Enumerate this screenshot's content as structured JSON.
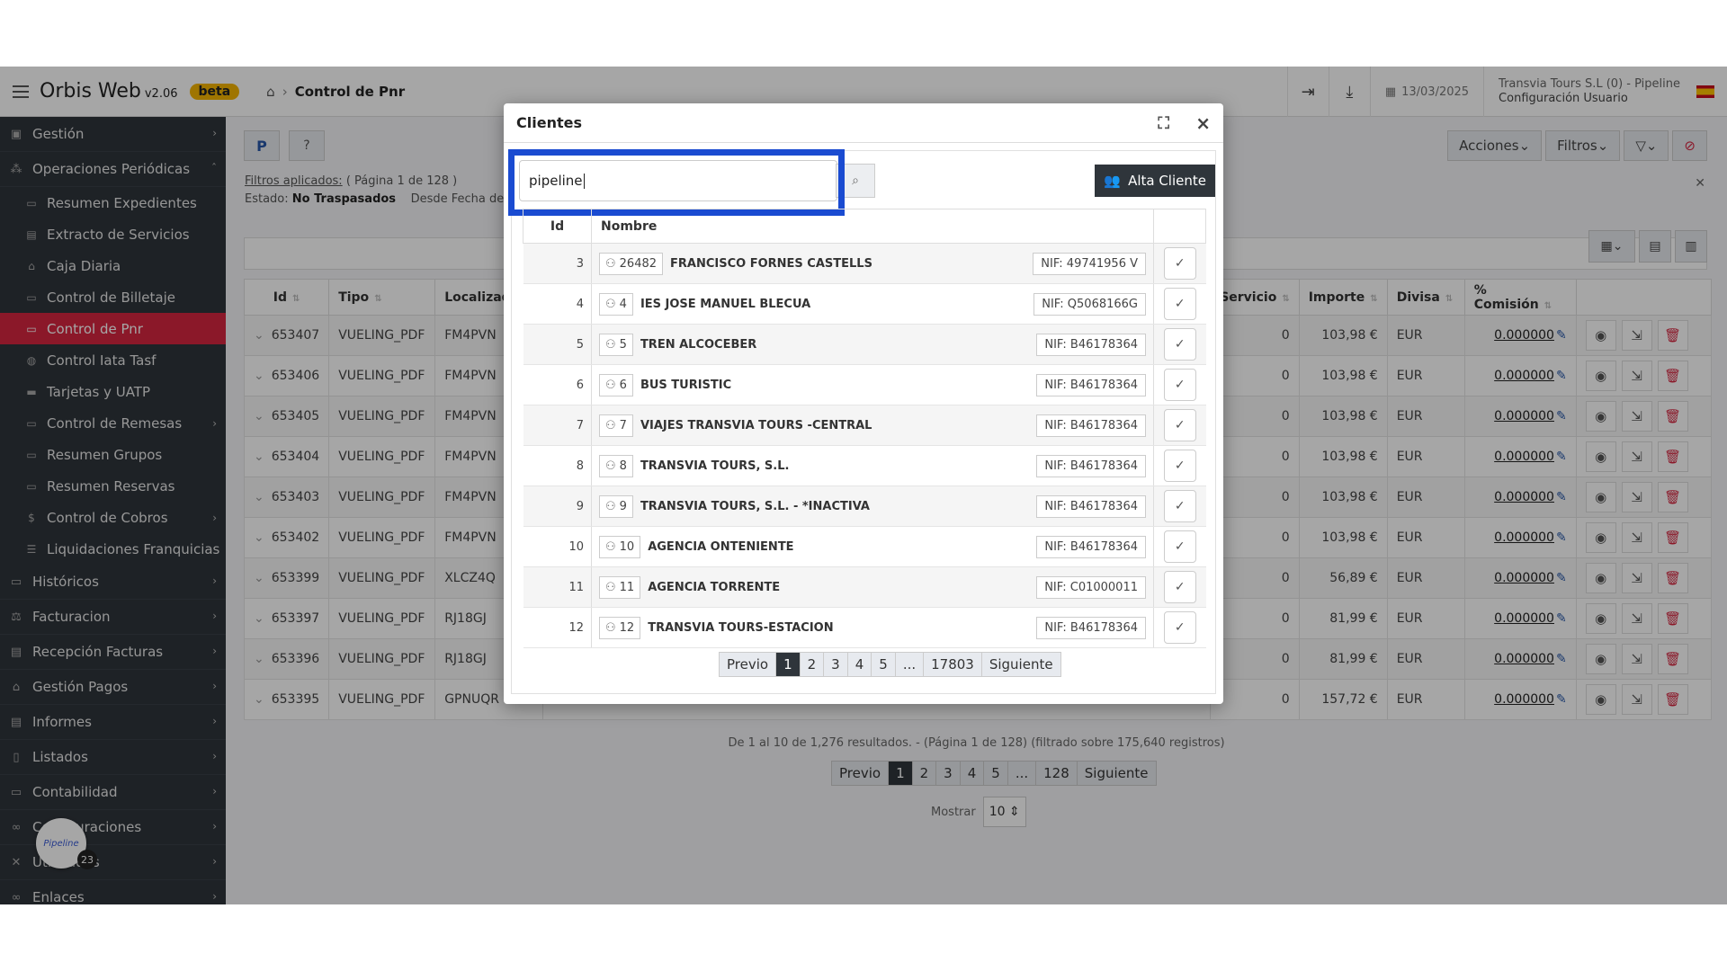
{
  "app": {
    "brand": "Orbis Web",
    "version": "v2.06",
    "beta": "beta"
  },
  "breadcrumb": {
    "page": "Control de Pnr"
  },
  "topbar": {
    "date": "13/03/2025",
    "user_line1": "Transvia Tours S.L (0) - Pipeline",
    "user_line2": "Configuración Usuario"
  },
  "sidebar": {
    "items": [
      {
        "label": "Gestión"
      },
      {
        "label": "Operaciones Periódicas"
      }
    ],
    "sub": [
      {
        "label": "Resumen Expedientes"
      },
      {
        "label": "Extracto de Servicios"
      },
      {
        "label": "Caja Diaria"
      },
      {
        "label": "Control de Billetaje"
      },
      {
        "label": "Control de Pnr"
      },
      {
        "label": "Control Iata Tasf"
      },
      {
        "label": "Tarjetas y UATP"
      },
      {
        "label": "Control de Remesas"
      },
      {
        "label": "Resumen Grupos"
      },
      {
        "label": "Resumen Reservas"
      },
      {
        "label": "Control de Cobros"
      },
      {
        "label": "Liquidaciones Franquicias"
      }
    ],
    "bottom": [
      {
        "label": "Históricos"
      },
      {
        "label": "Facturacion"
      },
      {
        "label": "Recepción Facturas"
      },
      {
        "label": "Gestión Pagos"
      },
      {
        "label": "Informes"
      },
      {
        "label": "Listados"
      },
      {
        "label": "Contabilidad"
      },
      {
        "label": "Configuraciones"
      },
      {
        "label": "Utilidades"
      },
      {
        "label": "Enlaces"
      }
    ],
    "pipeline_label": "Pipeline",
    "pipeline_count": "23"
  },
  "main": {
    "btn_p": "P",
    "filters_label": "Filtros aplicados:",
    "filters_page": "( Página 1 de 128 )",
    "estado_label": "Estado:",
    "estado_value": "No Traspasados",
    "desde": "Desde Fecha de Emi",
    "actions": {
      "acciones": "Acciones",
      "filtros": "Filtros"
    },
    "columns": {
      "id": "Id",
      "tipo": "Tipo",
      "loc": "Localizado",
      "servicio": "Servicio",
      "importe": "Importe",
      "divisa": "Divisa",
      "comision": "% Comisión"
    },
    "rows": [
      {
        "id": "653407",
        "tipo": "VUELING_PDF",
        "loc": "FM4PVN",
        "servicio": "0",
        "importe": "103,98 €",
        "divisa": "EUR",
        "comision": "0.000000"
      },
      {
        "id": "653406",
        "tipo": "VUELING_PDF",
        "loc": "FM4PVN",
        "servicio": "0",
        "importe": "103,98 €",
        "divisa": "EUR",
        "comision": "0.000000"
      },
      {
        "id": "653405",
        "tipo": "VUELING_PDF",
        "loc": "FM4PVN",
        "servicio": "0",
        "importe": "103,98 €",
        "divisa": "EUR",
        "comision": "0.000000"
      },
      {
        "id": "653404",
        "tipo": "VUELING_PDF",
        "loc": "FM4PVN",
        "servicio": "0",
        "importe": "103,98 €",
        "divisa": "EUR",
        "comision": "0.000000"
      },
      {
        "id": "653403",
        "tipo": "VUELING_PDF",
        "loc": "FM4PVN",
        "servicio": "0",
        "importe": "103,98 €",
        "divisa": "EUR",
        "comision": "0.000000"
      },
      {
        "id": "653402",
        "tipo": "VUELING_PDF",
        "loc": "FM4PVN",
        "servicio": "0",
        "importe": "103,98 €",
        "divisa": "EUR",
        "comision": "0.000000"
      },
      {
        "id": "653399",
        "tipo": "VUELING_PDF",
        "loc": "XLCZ4Q",
        "servicio": "0",
        "importe": "56,89 €",
        "divisa": "EUR",
        "comision": "0.000000"
      },
      {
        "id": "653397",
        "tipo": "VUELING_PDF",
        "loc": "RJ18GJ",
        "servicio": "0",
        "importe": "81,99 €",
        "divisa": "EUR",
        "comision": "0.000000"
      },
      {
        "id": "653396",
        "tipo": "VUELING_PDF",
        "loc": "RJ18GJ",
        "servicio": "0",
        "importe": "81,99 €",
        "divisa": "EUR",
        "comision": "0.000000"
      },
      {
        "id": "653395",
        "tipo": "VUELING_PDF",
        "loc": "GPNUQR",
        "servicio": "0",
        "importe": "157,72 €",
        "divisa": "EUR",
        "comision": "0.000000"
      }
    ],
    "summary": "De 1 al 10 de 1,276 resultados. - (Página 1 de 128) (filtrado sobre 175,640 registros)",
    "pager": {
      "prev": "Previo",
      "p1": "1",
      "p2": "2",
      "p3": "3",
      "p4": "4",
      "p5": "5",
      "dots": "...",
      "last": "128",
      "next": "Siguiente"
    },
    "mostrar_label": "Mostrar",
    "mostrar_value": "10"
  },
  "modal": {
    "title": "Clientes",
    "search_value": "pipeline",
    "alta_label": "Alta Cliente",
    "col_id": "Id",
    "col_nombre": "Nombre",
    "rows": [
      {
        "id": "3",
        "code": "26482",
        "name": "FRANCISCO FORNES CASTELLS",
        "nif": "NIF: 49741956 V"
      },
      {
        "id": "4",
        "code": "4",
        "name": "IES JOSE MANUEL BLECUA",
        "nif": "NIF: Q5068166G"
      },
      {
        "id": "5",
        "code": "5",
        "name": "TREN ALCOCEBER",
        "nif": "NIF: B46178364"
      },
      {
        "id": "6",
        "code": "6",
        "name": "BUS TURISTIC",
        "nif": "NIF: B46178364"
      },
      {
        "id": "7",
        "code": "7",
        "name": "VIAJES TRANSVIA TOURS -CENTRAL",
        "nif": "NIF: B46178364"
      },
      {
        "id": "8",
        "code": "8",
        "name": "TRANSVIA TOURS, S.L.",
        "nif": "NIF: B46178364"
      },
      {
        "id": "9",
        "code": "9",
        "name": "TRANSVIA TOURS, S.L. - *INACTIVA",
        "nif": "NIF: B46178364"
      },
      {
        "id": "10",
        "code": "10",
        "name": "AGENCIA ONTENIENTE",
        "nif": "NIF: B46178364"
      },
      {
        "id": "11",
        "code": "11",
        "name": "AGENCIA TORRENTE",
        "nif": "NIF: C01000011"
      },
      {
        "id": "12",
        "code": "12",
        "name": "TRANSVIA TOURS-ESTACION",
        "nif": "NIF: B46178364"
      }
    ],
    "pager": {
      "prev": "Previo",
      "p1": "1",
      "p2": "2",
      "p3": "3",
      "p4": "4",
      "p5": "5",
      "dots": "...",
      "last": "17803",
      "next": "Siguiente"
    }
  },
  "colors": {
    "accent": "#d62640",
    "sidebar": "#2f353b",
    "highlight": "#1a4bd1",
    "beta": "#f5b400"
  }
}
